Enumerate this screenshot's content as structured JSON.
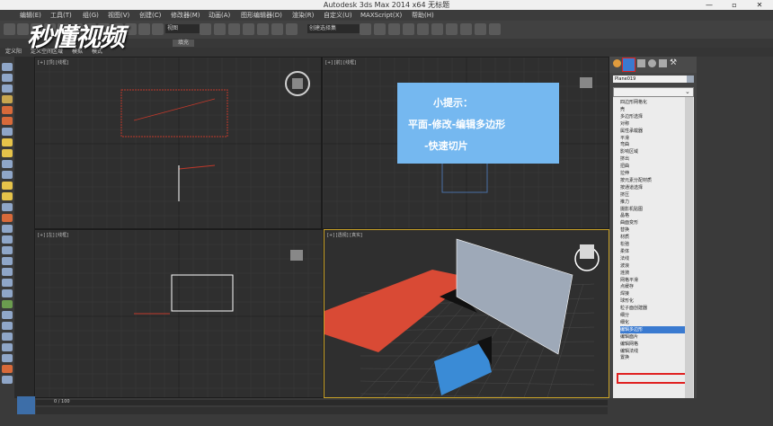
{
  "window": {
    "title": "Autodesk 3ds Max  2014 x64     无标题"
  },
  "menu": [
    "编辑(E)",
    "工具(T)",
    "组(G)",
    "视图(V)",
    "创建(C)",
    "修改器(M)",
    "动画(A)",
    "图形编辑器(D)",
    "渲染(R)",
    "自定义(U)",
    "MAXScript(X)",
    "帮助(H)"
  ],
  "toolbar": {
    "view_dropdown": "视图",
    "selection_set": "创建选择集",
    "fill_label": "填充"
  },
  "ribbon": {
    "tabs": [
      "定义阳",
      "定义空间区域",
      "模拟",
      "模式"
    ]
  },
  "viewports": {
    "top_left": "[+] [顶] [线框]",
    "top_right": "[+] [前] [线框]",
    "bottom_left": "[+] [左] [线框]",
    "bottom_right": "[+] [透视] [真实]"
  },
  "hint": {
    "title": "小提示：",
    "line1": "平面-修改-编辑多边形",
    "line2": "-快速切片"
  },
  "command_panel": {
    "object_name": "Plane019",
    "modifier_list": [
      "四边形网格化",
      "壳",
      "多边形选择",
      "对称",
      "属性承载器",
      "平滑",
      "弯曲",
      "影响区域",
      "挤出",
      "扭曲",
      "拉伸",
      "按元素分配材质",
      "按通道选择",
      "挤压",
      "推力",
      "摄影机贴图",
      "晶格",
      "曲面变形",
      "替换",
      "材质",
      "松弛",
      "柔体",
      "法线",
      "波浪",
      "涟漪",
      "网格平滑",
      "点缓存",
      "焊接",
      "球形化",
      "粒子面创建器",
      "细分",
      "细化",
      "编辑多边形",
      "编辑面片",
      "编辑网格",
      "编辑法线",
      "置换"
    ],
    "selected_item": "编辑多边形"
  },
  "status": {
    "frame": "0 / 100"
  },
  "watermark": "秒懂视频",
  "colors": {
    "hint_bg": "#75b8f0",
    "red_plane": "#d94a35",
    "grey_plane": "#9ea9b8",
    "blue_box": "#3a8bd6",
    "highlight": "#e02020"
  }
}
